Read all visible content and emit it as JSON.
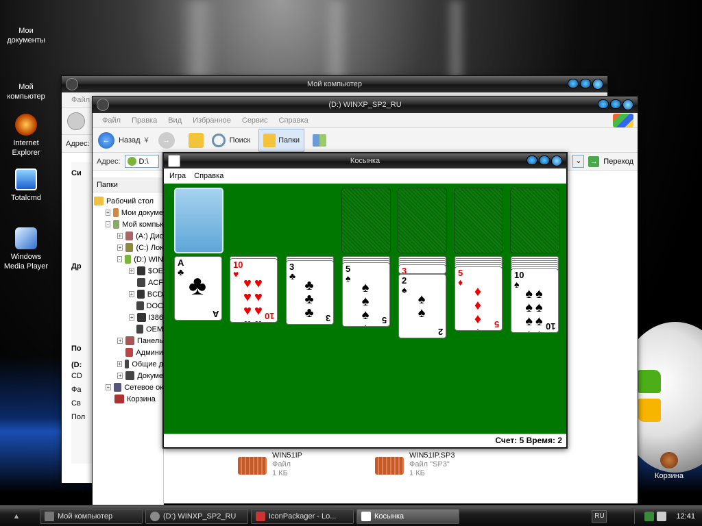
{
  "desktop": {
    "icons": [
      {
        "label": "Мои документы"
      },
      {
        "label": "Мой компьютер"
      },
      {
        "label": "Internet Explorer"
      },
      {
        "label": "Totalcmd"
      },
      {
        "label": "Windows Media Player"
      },
      {
        "label": "Корзина"
      }
    ]
  },
  "win_mycomputer": {
    "title": "Мой компьютер",
    "menu_file": "Файл",
    "address_label": "Адрес:",
    "side_partial": [
      "Си",
      "Др",
      "По"
    ],
    "details_partial": [
      "(D:",
      "CD",
      "Фа",
      "Св",
      "Пол"
    ]
  },
  "win_explorer": {
    "title": "(D:) WINXP_SP2_RU",
    "menu": [
      "Файл",
      "Правка",
      "Вид",
      "Избранное",
      "Сервис",
      "Справка"
    ],
    "toolbar": {
      "back": "Назад",
      "search": "Поиск",
      "folders": "Папки"
    },
    "address_label": "Адрес:",
    "address_value": "D:\\",
    "go": "Переход",
    "folders_pane_title": "Папки",
    "tree": [
      {
        "label": "Рабочий стол",
        "depth": 0,
        "pm": ""
      },
      {
        "label": "Мои докуме",
        "depth": 1,
        "pm": "+"
      },
      {
        "label": "Мой компьк",
        "depth": 1,
        "pm": "−"
      },
      {
        "label": "(A:) Дис",
        "depth": 2,
        "pm": "+"
      },
      {
        "label": "(C:) Лок",
        "depth": 2,
        "pm": "+"
      },
      {
        "label": "(D:) WIN",
        "depth": 2,
        "pm": "−"
      },
      {
        "label": "$OE",
        "depth": 3,
        "pm": "+"
      },
      {
        "label": "ACF",
        "depth": 3,
        "pm": ""
      },
      {
        "label": "BCD",
        "depth": 3,
        "pm": "+"
      },
      {
        "label": "DOC",
        "depth": 3,
        "pm": ""
      },
      {
        "label": "I386",
        "depth": 3,
        "pm": "+"
      },
      {
        "label": "OEM",
        "depth": 3,
        "pm": ""
      },
      {
        "label": "Панель",
        "depth": 2,
        "pm": "+"
      },
      {
        "label": "Админи",
        "depth": 2,
        "pm": ""
      },
      {
        "label": "Общие д",
        "depth": 2,
        "pm": "+"
      },
      {
        "label": "Докуме",
        "depth": 2,
        "pm": "+"
      },
      {
        "label": "Сетевое ок",
        "depth": 1,
        "pm": "+"
      },
      {
        "label": "Корзина",
        "depth": 1,
        "pm": ""
      }
    ],
    "files": [
      {
        "name": "WIN51IP",
        "type": "Файл",
        "size": "1 КБ"
      },
      {
        "name": "WIN51IP.SP3",
        "type": "Файл \"SP3\"",
        "size": "1 КБ"
      }
    ]
  },
  "solitaire": {
    "title": "Косынка",
    "menu": [
      "Игра",
      "Справка"
    ],
    "status": "Счет: 5 Время: 2",
    "tableau": [
      {
        "rank": "A",
        "suit": "♣",
        "color": "black",
        "hidden": 0
      },
      {
        "rank": "10",
        "suit": "♥",
        "color": "red",
        "hidden": 1
      },
      {
        "rank": "3",
        "suit": "♣",
        "color": "black",
        "hidden": 2
      },
      {
        "rank": "5",
        "suit": "♠",
        "color": "black",
        "hidden": 3
      },
      {
        "rank": "2",
        "suit": "♠",
        "color": "black",
        "hidden": 4,
        "under": {
          "rank": "3",
          "suit": "♦",
          "color": "red"
        }
      },
      {
        "rank": "5",
        "suit": "♦",
        "color": "red",
        "hidden": 5
      },
      {
        "rank": "10",
        "suit": "♠",
        "color": "black",
        "hidden": 6
      }
    ]
  },
  "taskbar": {
    "buttons": [
      {
        "label": "Мой компьютер"
      },
      {
        "label": "(D:) WINXP_SP2_RU"
      },
      {
        "label": "IconPackager - Lo..."
      },
      {
        "label": "Косынка"
      }
    ],
    "lang": "RU",
    "clock": "12:41"
  }
}
